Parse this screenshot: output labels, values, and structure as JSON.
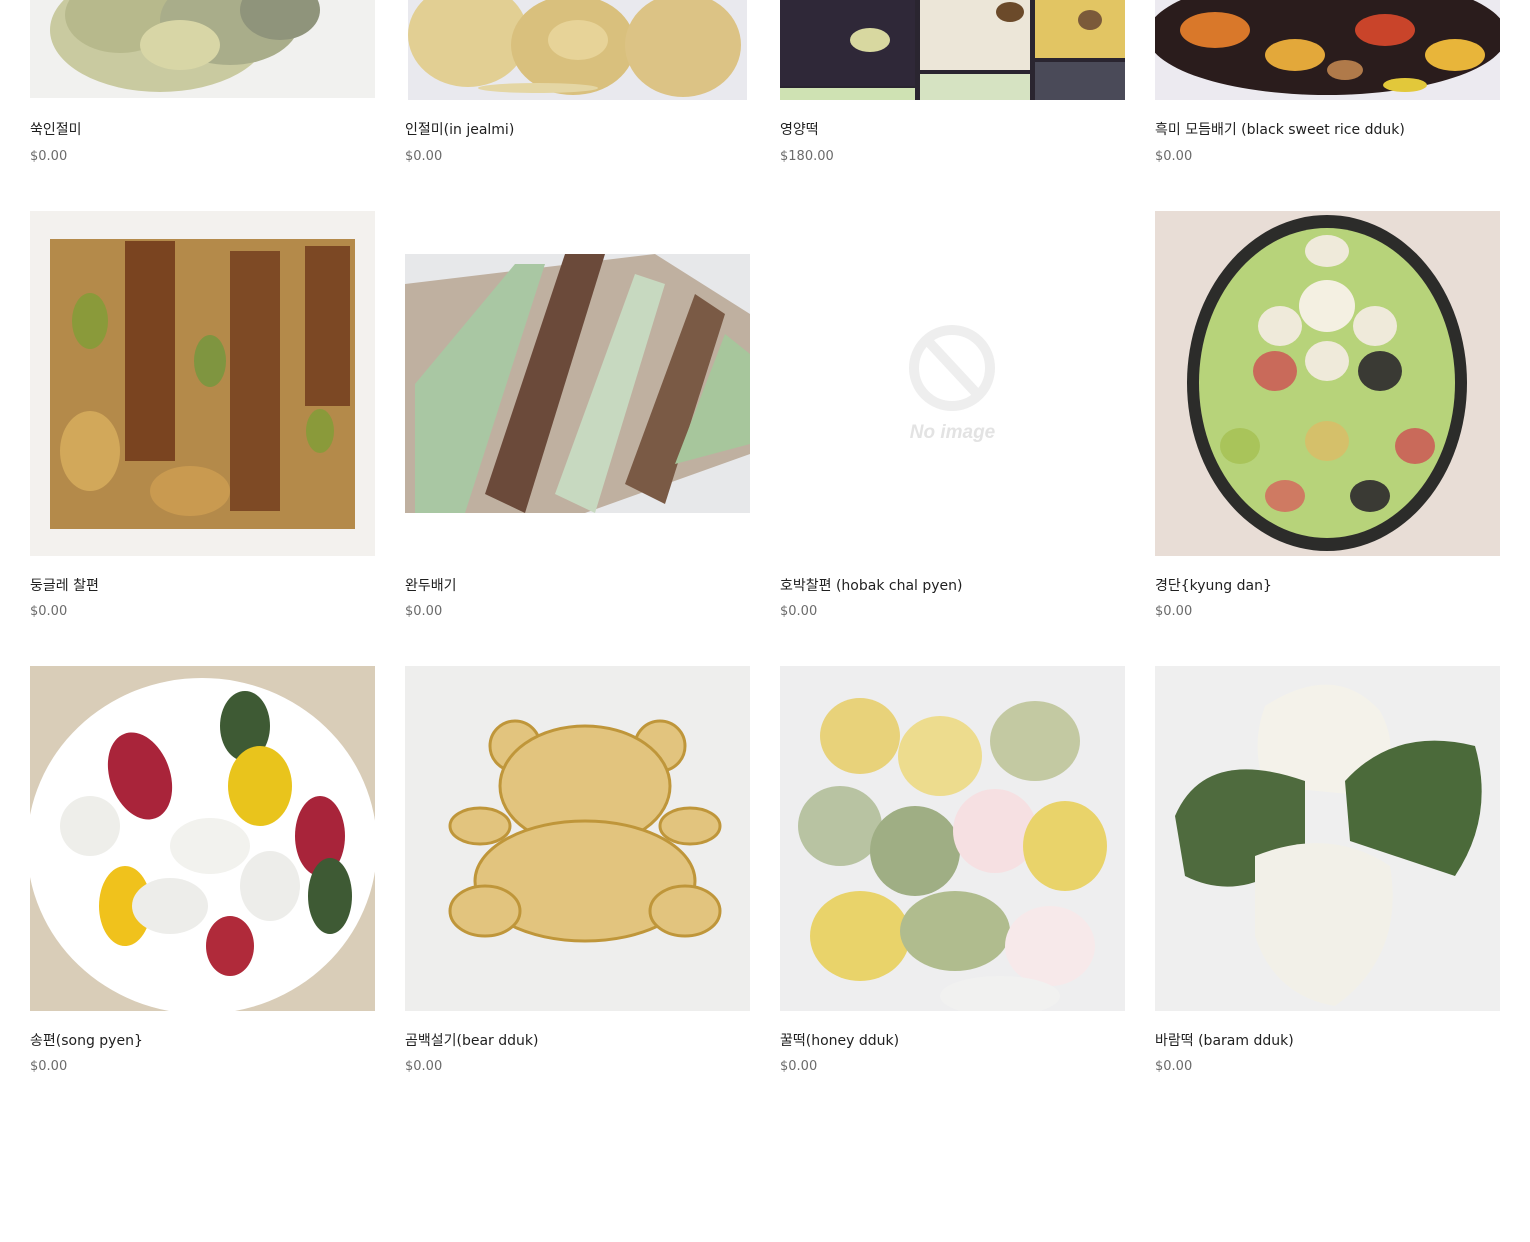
{
  "products": [
    {
      "name": "쑥인절미",
      "price": "$0.00",
      "image": "mugwort-injeolmi-photo"
    },
    {
      "name": "인절미(in jealmi)",
      "price": "$0.00",
      "image": "injeolmi-photo"
    },
    {
      "name": "영양떡",
      "price": "$180.00",
      "image": "nutrition-rice-cake-photo"
    },
    {
      "name": "흑미 모듬배기 (black sweet rice dduk)",
      "price": "$0.00",
      "image": "black-rice-mixed-photo"
    },
    {
      "name": "둥글레 찰편",
      "price": "$0.00",
      "image": "fig-chalpyeon-photo"
    },
    {
      "name": "완두배기",
      "price": "$0.00",
      "image": "pea-rice-cake-photo"
    },
    {
      "name": "호박찰편 (hobak chal pyen)",
      "price": "$0.00",
      "image": "no-image-placeholder",
      "placeholder_text": "No image"
    },
    {
      "name": "경단{kyung dan}",
      "price": "$0.00",
      "image": "kyungdan-platter-photo"
    },
    {
      "name": "송편(song pyen}",
      "price": "$0.00",
      "image": "songpyeon-plate-photo"
    },
    {
      "name": "곰백설기(bear dduk)",
      "price": "$0.00",
      "image": "bear-baekseolgi-photo"
    },
    {
      "name": "꿀떡(honey dduk)",
      "price": "$0.00",
      "image": "honey-dduk-photo"
    },
    {
      "name": "바람떡 (baram dduk)",
      "price": "$0.00",
      "image": "baram-dduk-photo"
    }
  ]
}
